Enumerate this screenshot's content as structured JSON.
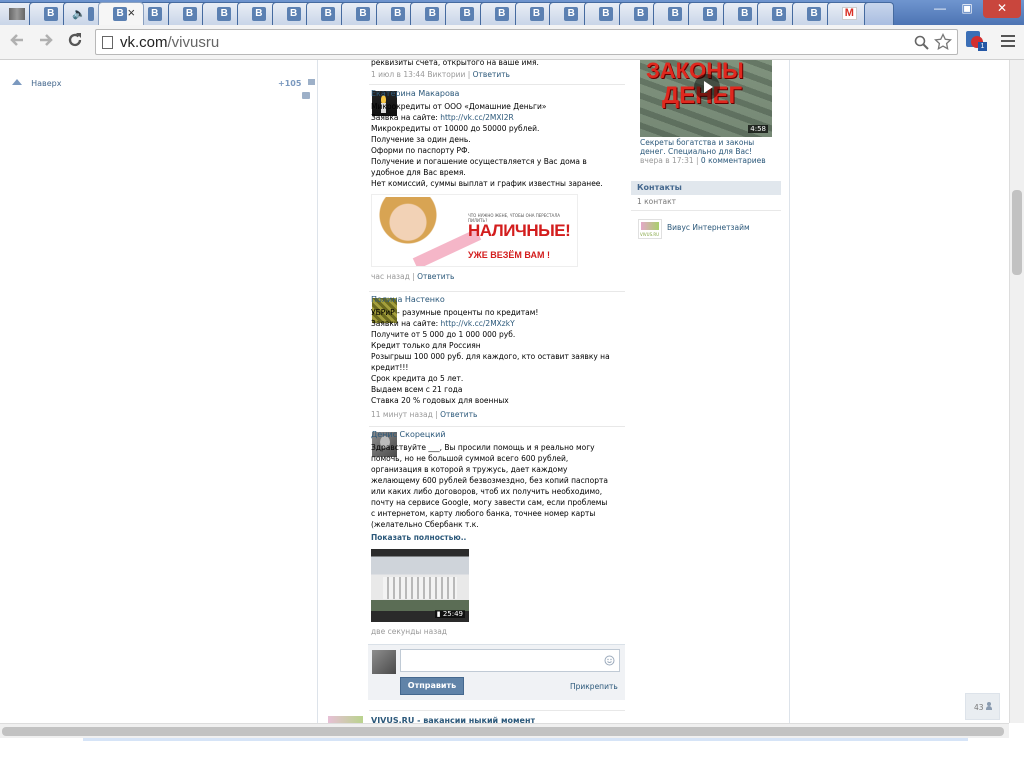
{
  "browser": {
    "tab_icons": [
      "vk-photo",
      "vk",
      "audio",
      "vk",
      "vk",
      "vk",
      "vk",
      "vk",
      "vk",
      "vk",
      "vk",
      "vk",
      "vk",
      "vk",
      "vk",
      "vk",
      "vk",
      "vk",
      "vk",
      "vk",
      "vk",
      "vk",
      "vk",
      "vk",
      "gmail",
      "new-tab"
    ],
    "tab_letter": "B",
    "gmail_letter": "M",
    "active_close": "×",
    "url_host": "vk.com",
    "url_path": "/vivusru",
    "win_min": "—",
    "win_max": "▣",
    "win_close": "✕"
  },
  "left": {
    "top_link": "Наверх",
    "counter": "+105"
  },
  "posts": [
    {
      "lines": [
        "реквизиты счета, открытого на ваше имя."
      ],
      "meta": "1 июл в 13:44 Виктории",
      "reply": "Ответить"
    },
    {
      "author": "Екатерина Макарова",
      "lines": [
        "Микрокредиты от ООО «Домашние Деньги»",
        "Заявка на сайте: ",
        "Микрокредиты от 10000 до 50000 рублей.",
        "Получение за один день.",
        "Оформи по паспорту РФ.",
        "Получение и погашение осуществляется у Вас дома в",
        "удобное для Вас время.",
        "Нет комиссий, суммы выплат и график известны заранее."
      ],
      "link": "http://vk.cc/2MXI2R",
      "banner_small": "ЧТО НУЖНО ЖЕНЕ, ЧТОБЫ ОНА ПЕРЕСТАЛА ПИЛИТЬ?",
      "banner_big": "НАЛИЧНЫЕ!",
      "banner_sub": "УЖЕ ВЕЗЁМ ВАМ !",
      "meta": "час назад",
      "reply": "Ответить"
    },
    {
      "author": "Полина Настенко",
      "lines": [
        "УБРиР - разумные проценты по кредитам!",
        "Заявки на сайте: ",
        "Получите от 5 000 до 1 000 000 руб.",
        "Кредит только для Россиян",
        "Розыгрыш 100 000 руб. для каждого, кто оставит заявку на",
        "кредит!!!",
        "Срок кредита до 5 лет.",
        "Выдаем всем с 21 года",
        "Ставка 20 % годовых для военных"
      ],
      "link": "http://vk.cc/2MXzkY",
      "meta": "11 минут назад",
      "reply": "Ответить"
    },
    {
      "author": "Денис Скорецкий",
      "lines": [
        "Здравствуйте ___, Вы просили помощь и я реально могу",
        "помочь, но не большой суммой всего 600 рублей,",
        "организация в которой я тружусь, дает каждому",
        "желающему 600 рублей безвозмездно, без копий паспорта",
        "или каких либо договоров, чтоб их получить необходимо,",
        "почту на сервисе Google, могу завести сам, если проблемы",
        "с интернетом, карту любого банка, точнее номер карты",
        "(желательно Сбербанк т.к."
      ],
      "more": "Показать полностью..",
      "video_time": "25:49",
      "meta": "две секунды назад"
    }
  ],
  "reply_box": {
    "send": "Отправить",
    "attach": "Прикрепить"
  },
  "next_post_title": "VIVUS.RU - вакансии ныкий момент",
  "right": {
    "video_title_1": "ЗАКОНЫ",
    "video_title_2": "ДЕНЕГ",
    "video_time": "4:58",
    "video_caption": "Секреты богатства и законы денег. Специально для Вас!",
    "video_date": "вчера в 17:31",
    "video_comments": "0 комментариев",
    "contacts_header": "Контакты",
    "contacts_count": "1 контакт",
    "contact_name": "Вивус Интернетзайм",
    "contact_logo": "VIVUS.RU"
  },
  "online_count": "43"
}
